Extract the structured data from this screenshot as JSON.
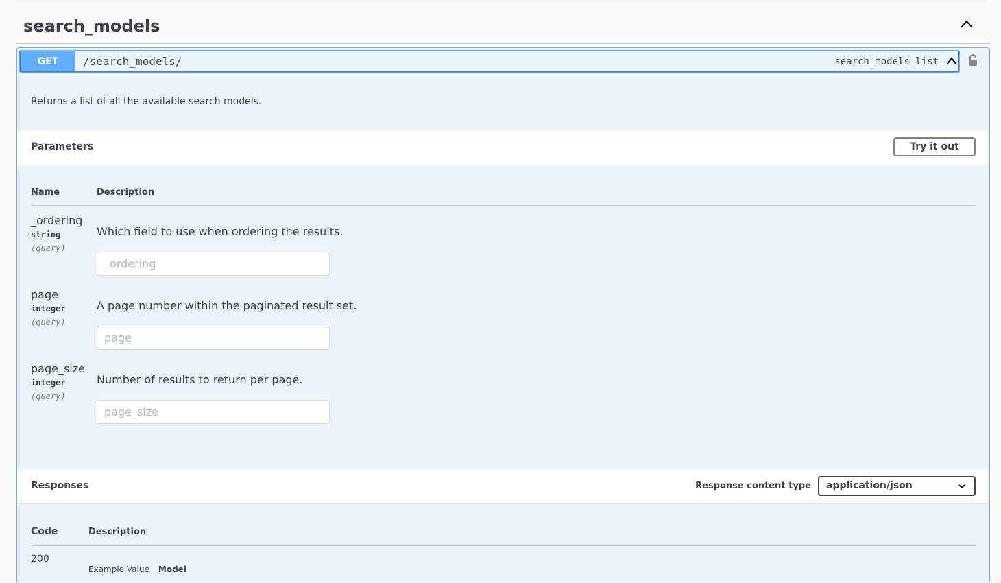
{
  "tag": {
    "title": "search_models"
  },
  "operation": {
    "method": "GET",
    "path": "/search_models/",
    "operation_id": "search_models_list",
    "description": "Returns a list of all the available search models."
  },
  "parameters": {
    "heading": "Parameters",
    "try_label": "Try it out",
    "col_name": "Name",
    "col_description": "Description",
    "items": [
      {
        "name": "_ordering",
        "type": "string",
        "in": "(query)",
        "description": "Which field to use when ordering the results.",
        "placeholder": "_ordering"
      },
      {
        "name": "page",
        "type": "integer",
        "in": "(query)",
        "description": "A page number within the paginated result set.",
        "placeholder": "page"
      },
      {
        "name": "page_size",
        "type": "integer",
        "in": "(query)",
        "description": "Number of results to return per page.",
        "placeholder": "page_size"
      }
    ]
  },
  "responses": {
    "heading": "Responses",
    "content_type_label": "Response content type",
    "content_type_value": "application/json",
    "col_code": "Code",
    "col_description": "Description",
    "rows": [
      {
        "code": "200",
        "tab_example": "Example Value",
        "tab_model": "Model"
      }
    ]
  },
  "colors": {
    "get_accent": "#61affe",
    "get_bg": "#ebf3fb",
    "text": "#3b4151"
  },
  "icons": {
    "collapse": "chevron-up-icon",
    "lock": "lock-icon",
    "select": "chevron-down-icon"
  }
}
